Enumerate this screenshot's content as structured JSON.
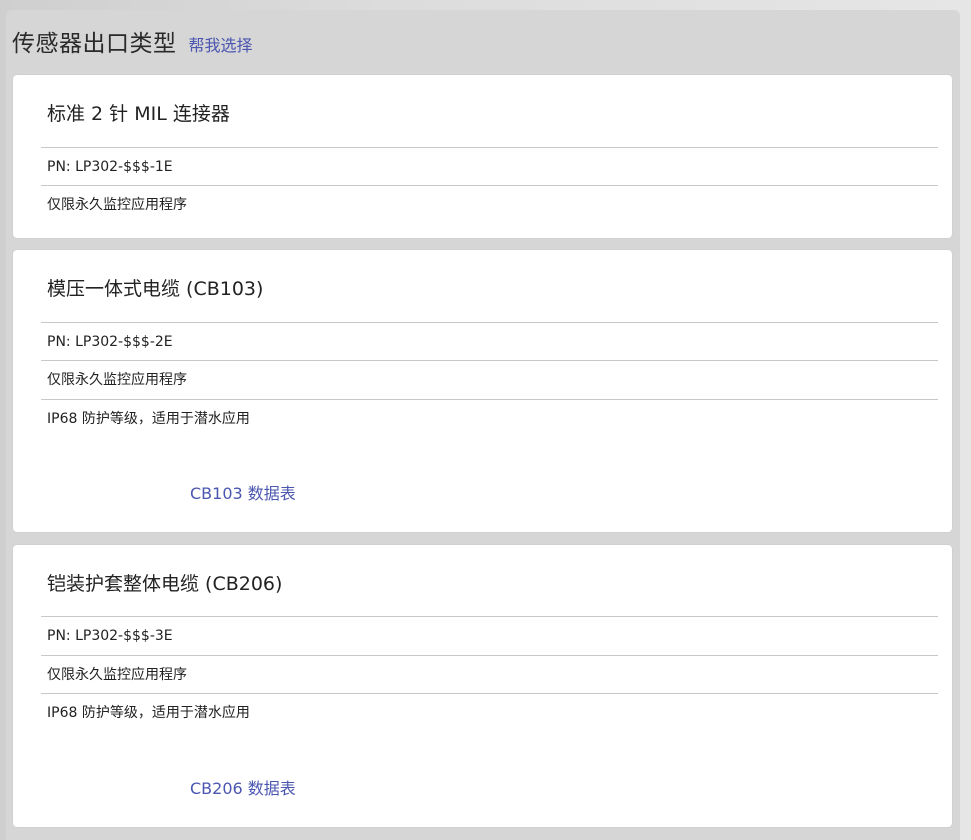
{
  "header": {
    "title": "传感器出口类型",
    "help_link": "帮我选择"
  },
  "options": [
    {
      "title": "标准 2 针 MIL 连接器",
      "pn": "PN: LP302-$$$-1E",
      "features": [
        "仅限永久监控应用程序"
      ]
    },
    {
      "title": "模压一体式电缆 (CB103)",
      "pn": "PN: LP302-$$$-2E",
      "features": [
        "仅限永久监控应用程序",
        "IP68 防护等级，适用于潜水应用"
      ],
      "datasheet": "CB103 数据表"
    },
    {
      "title": "铠装护套整体电缆 (CB206)",
      "pn": "PN: LP302-$$$-3E",
      "features": [
        "仅限永久监控应用程序",
        "IP68 防护等级，适用于潜水应用"
      ],
      "datasheet": "CB206 数据表"
    }
  ]
}
